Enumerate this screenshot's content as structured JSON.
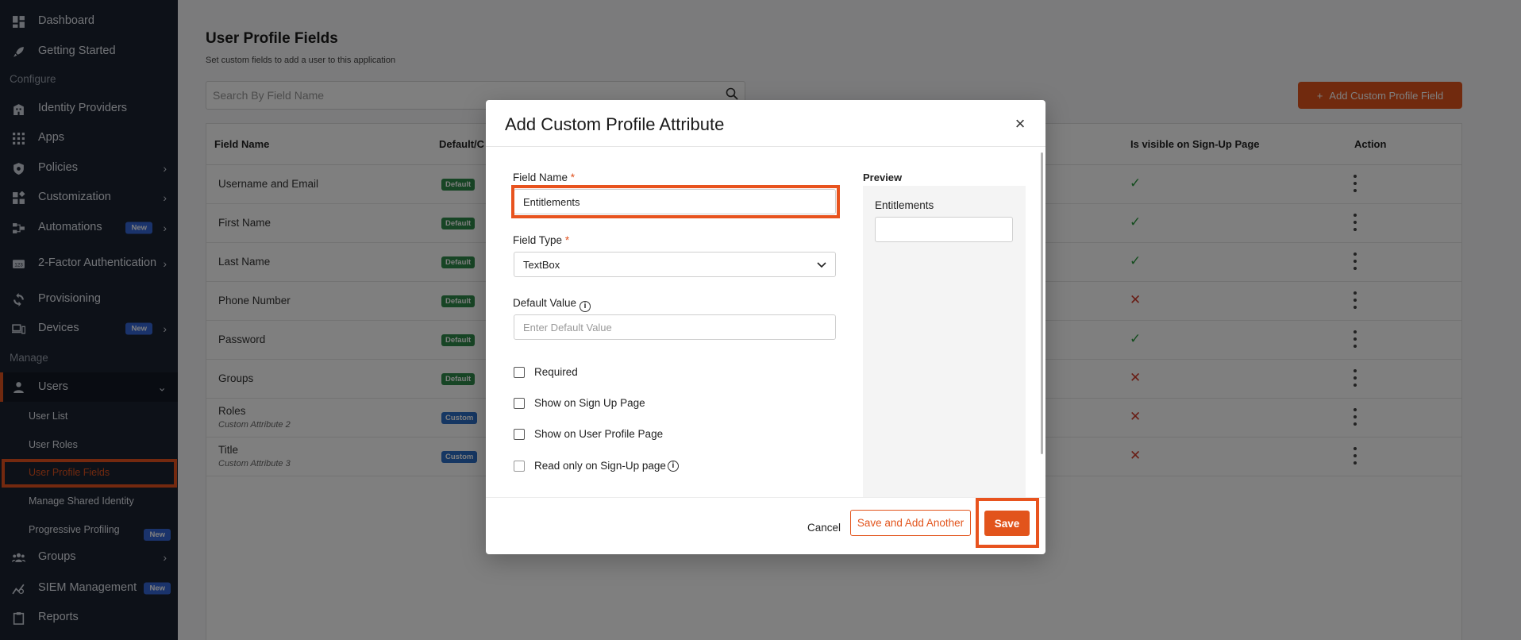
{
  "sidebar": {
    "items": [
      {
        "label": "Dashboard",
        "icon": "dashboard-icon"
      },
      {
        "label": "Getting Started",
        "icon": "rocket-icon"
      },
      {
        "label": "Identity Providers",
        "icon": "building-icon"
      },
      {
        "label": "Apps",
        "icon": "apps-grid-icon"
      },
      {
        "label": "Policies",
        "icon": "shield-icon"
      },
      {
        "label": "Customization",
        "icon": "widgets-icon"
      },
      {
        "label": "Automations",
        "icon": "automation-icon",
        "badge": "New"
      },
      {
        "label": "2-Factor Authentication",
        "icon": "two-factor-icon"
      },
      {
        "label": "Provisioning",
        "icon": "sync-icon"
      },
      {
        "label": "Devices",
        "icon": "devices-icon",
        "badge": "New"
      },
      {
        "label": "Users",
        "icon": "user-icon"
      },
      {
        "label": "Groups",
        "icon": "groups-icon"
      },
      {
        "label": "SIEM Management",
        "icon": "siem-icon",
        "badge": "New"
      },
      {
        "label": "Reports",
        "icon": "clipboard-icon"
      }
    ],
    "sections": {
      "configure": "Configure",
      "manage": "Manage"
    },
    "users_sub": [
      {
        "label": "User List"
      },
      {
        "label": "User Roles"
      },
      {
        "label": "User Profile Fields"
      },
      {
        "label": "Manage Shared Identity"
      },
      {
        "label": "Progressive Profiling",
        "badge": "New"
      }
    ]
  },
  "page": {
    "title": "User Profile Fields",
    "subtitle": "Set custom fields to add a user to this application",
    "search_placeholder": "Search By Field Name",
    "add_button": "Add Custom Profile Field"
  },
  "table": {
    "headers": {
      "field_name": "Field Name",
      "type": "Default/C",
      "visible": "Is visible on Sign-Up Page",
      "action": "Action"
    },
    "rows": [
      {
        "name": "Username and Email",
        "type": "Default",
        "visible": true
      },
      {
        "name": "First Name",
        "type": "Default",
        "visible": true
      },
      {
        "name": "Last Name",
        "type": "Default",
        "visible": true
      },
      {
        "name": "Phone Number",
        "type": "Default",
        "visible": false
      },
      {
        "name": "Password",
        "type": "Default",
        "visible": true
      },
      {
        "name": "Groups",
        "type": "Default",
        "visible": false
      },
      {
        "name": "Roles",
        "sub": "Custom Attribute 2",
        "type": "Custom",
        "visible": false
      },
      {
        "name": "Title",
        "sub": "Custom Attribute 3",
        "type": "Custom",
        "visible": false
      }
    ],
    "check": "✓",
    "cross": "✕"
  },
  "modal": {
    "title": "Add Custom Profile Attribute",
    "close": "×",
    "field_name_label": "Field Name",
    "required_mark": "*",
    "field_name_value": "Entitlements",
    "field_type_label": "Field Type",
    "field_type_value": "TextBox",
    "default_value_label": "Default Value",
    "default_value_placeholder": "Enter Default Value",
    "checkboxes": {
      "required": "Required",
      "show_signup": "Show on Sign Up Page",
      "show_profile": "Show on User Profile Page",
      "read_only": "Read only on Sign-Up page"
    },
    "preview_label": "Preview",
    "preview_field_label": "Entitlements",
    "cancel": "Cancel",
    "save_another": "Save and Add Another",
    "save": "Save"
  },
  "colors": {
    "accent": "#e2541c",
    "sidebar_bg": "#1b2230",
    "highlight": "#e8531e"
  }
}
